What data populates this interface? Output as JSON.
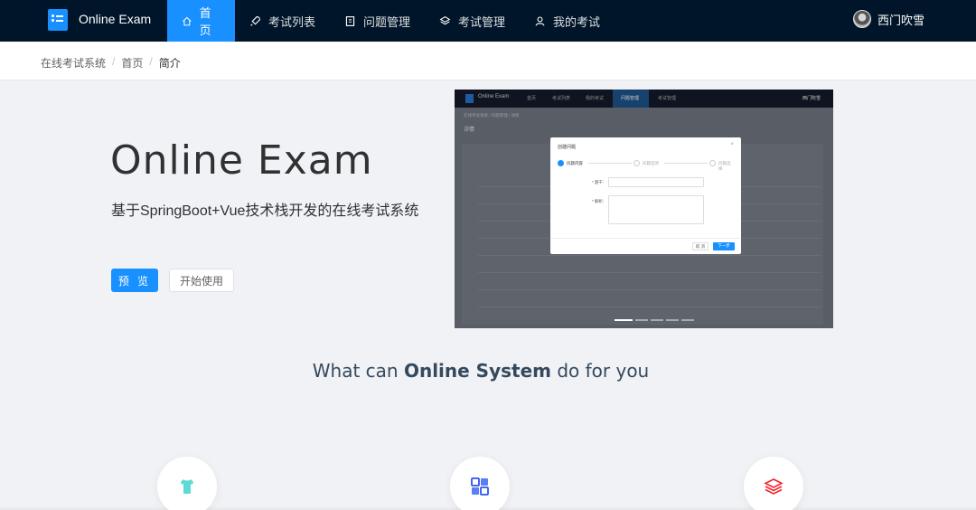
{
  "app": {
    "brand": "Online Exam",
    "user_name": "西门吹雪"
  },
  "nav": {
    "items": [
      {
        "label": "首页",
        "icon": "home-icon",
        "active": true
      },
      {
        "label": "考试列表",
        "icon": "rocket-icon",
        "active": false
      },
      {
        "label": "问题管理",
        "icon": "notebook-icon",
        "active": false
      },
      {
        "label": "考试管理",
        "icon": "layers-icon",
        "active": false
      },
      {
        "label": "我的考试",
        "icon": "user-icon",
        "active": false
      }
    ]
  },
  "breadcrumb": {
    "items": [
      "在线考试系统",
      "首页",
      "简介"
    ],
    "separator": "/"
  },
  "hero": {
    "title": "Online Exam",
    "subtitle": "基于SpringBoot+Vue技术栈开发的在线考试系统",
    "preview_button": "预 览",
    "start_button": "开始使用"
  },
  "carousel": {
    "active_slide": 1,
    "slide_count": 5,
    "preview": {
      "brand": "Online Exam",
      "nav": [
        "首页",
        "考试列表",
        "我的考试",
        "问题管理",
        "考试管理"
      ],
      "user": "西门吹雪",
      "breadcrumb": "在线考试系统 / 问题管理 / 详情",
      "page_title": "详情",
      "dialog": {
        "title": "创建问题",
        "steps": [
          "问题内容",
          "问题选项",
          "问题选择"
        ],
        "fields": [
          "* 题干:",
          "* 解析:"
        ],
        "cancel": "取 消",
        "next": "下一步"
      }
    }
  },
  "features": {
    "heading_pre": "What can ",
    "heading_bold": "Online System",
    "heading_post": " do for you",
    "items": [
      {
        "icon": "shirt-icon",
        "color": "#36cfc9"
      },
      {
        "icon": "grid-icon",
        "color": "#2f54eb"
      },
      {
        "icon": "stack-icon",
        "color": "#f5222d"
      }
    ]
  },
  "colors": {
    "nav_bg": "#001529",
    "accent": "#1890ff",
    "page_bg": "#f0f2f5"
  }
}
